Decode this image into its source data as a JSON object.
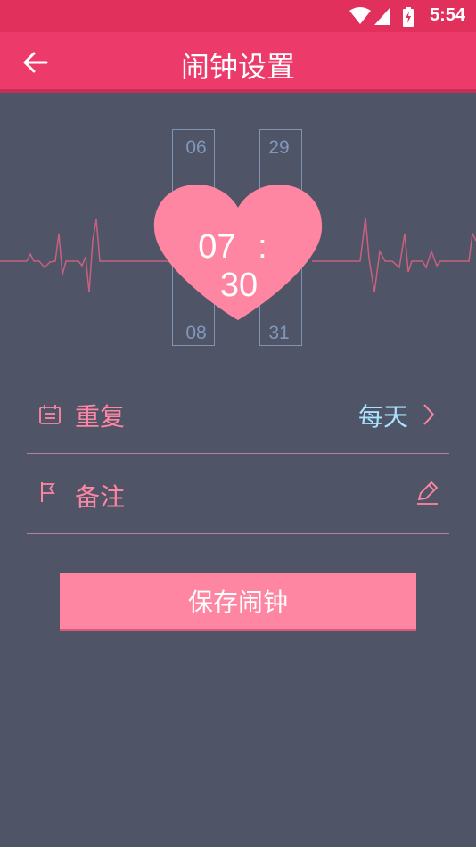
{
  "status_bar": {
    "time": "5:54"
  },
  "app_bar": {
    "title": "闹钟设置"
  },
  "picker": {
    "hour": {
      "prev": "06",
      "current": "07",
      "next": "08"
    },
    "minute": {
      "prev": "29",
      "current": "30",
      "next": "31"
    },
    "separator": ":"
  },
  "settings": {
    "repeat": {
      "label": "重复",
      "value": "每天"
    },
    "note": {
      "label": "备注"
    }
  },
  "save_button": {
    "label": "保存闹钟"
  },
  "colors": {
    "primary": "#ec3a6b",
    "accent": "#ff86a2",
    "background": "#4f5467",
    "value_text": "#a9e2ff"
  }
}
